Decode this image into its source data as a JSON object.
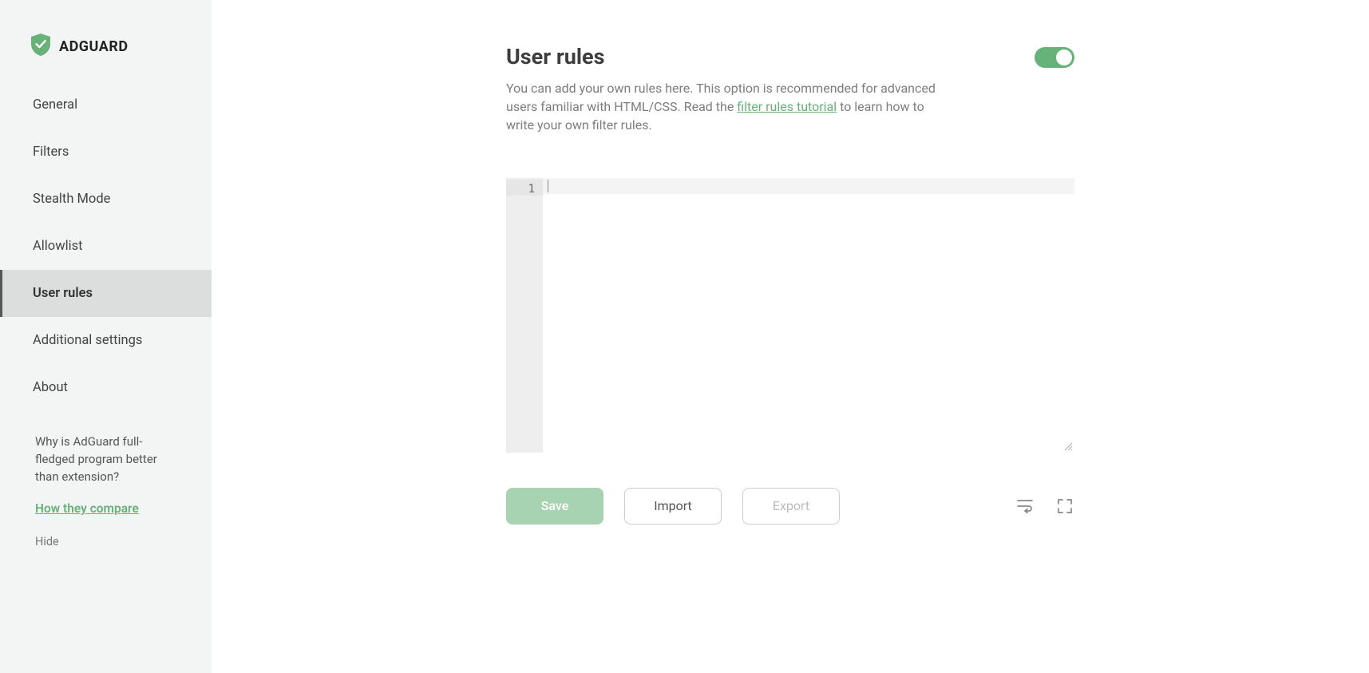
{
  "brand": {
    "name": "ADGUARD"
  },
  "sidebar": {
    "items": [
      {
        "label": "General"
      },
      {
        "label": "Filters"
      },
      {
        "label": "Stealth Mode"
      },
      {
        "label": "Allowlist"
      },
      {
        "label": "User rules"
      },
      {
        "label": "Additional settings"
      },
      {
        "label": "About"
      }
    ],
    "active_index": 4,
    "promo_text": "Why is AdGuard full-fledged program better than extension?",
    "compare_link": "How they compare",
    "hide_label": "Hide"
  },
  "page": {
    "title": "User rules",
    "desc_before": "You can add your own rules here. This option is recommended for advanced users familiar with HTML/CSS. Read the ",
    "desc_link": "filter rules tutorial",
    "desc_after": " to learn how to write your own filter rules.",
    "toggle_on": true
  },
  "editor": {
    "line_numbers": [
      "1"
    ],
    "content": ""
  },
  "actions": {
    "save": "Save",
    "import": "Import",
    "export": "Export"
  },
  "colors": {
    "accent": "#67b279",
    "sidebar_bg": "#f3f4f4",
    "active_bg": "#dcdddd"
  }
}
